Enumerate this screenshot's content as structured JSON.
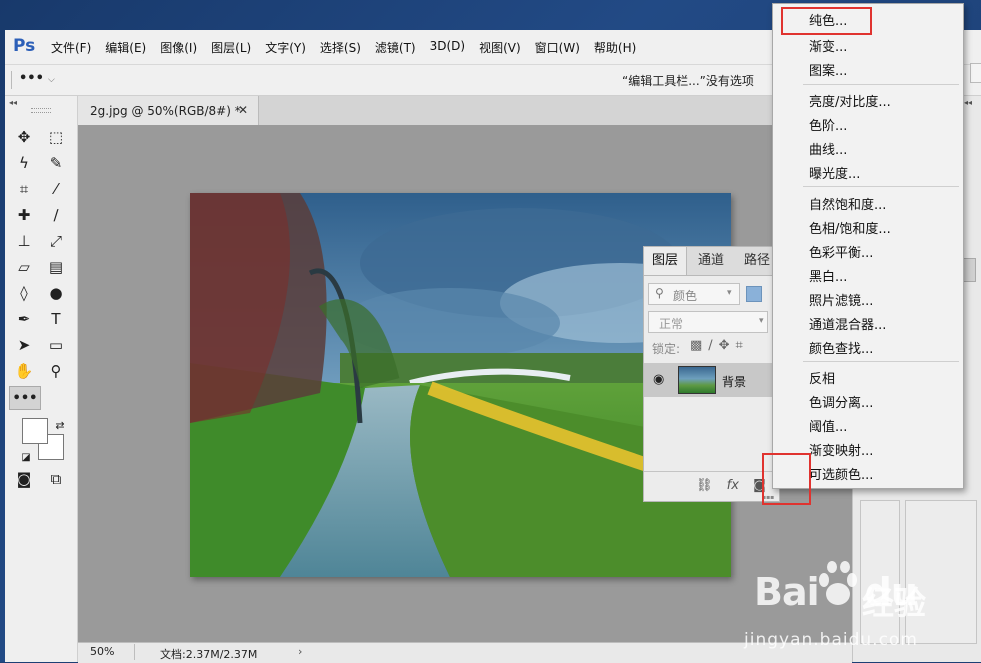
{
  "app": {
    "logo": "Ps"
  },
  "menubar": {
    "items": [
      "文件(F)",
      "编辑(E)",
      "图像(I)",
      "图层(L)",
      "文字(Y)",
      "选择(S)",
      "滤镜(T)",
      "3D(D)",
      "视图(V)",
      "窗口(W)",
      "帮助(H)"
    ]
  },
  "options_bar": {
    "tool_glyph": "•••",
    "message": "“编辑工具栏...”没有选项"
  },
  "document": {
    "tab_title": "2g.jpg @ 50%(RGB/8#) *",
    "close": "✕",
    "zoom": "50%",
    "doc_size": "文档:2.37M/2.37M",
    "status_arrow": "›"
  },
  "layers_panel": {
    "tabs": [
      "图层",
      "通道",
      "路径"
    ],
    "filter_placeholder": "颜色",
    "blend_mode": "正常",
    "lock_label": "锁定:",
    "layer_name": "背景",
    "footer_icons": [
      "link-icon",
      "fx-icon",
      "mask-icon",
      "adjustment-icon"
    ]
  },
  "adjustment_menu": {
    "groups": [
      [
        "纯色...",
        "渐变...",
        "图案..."
      ],
      [
        "亮度/对比度...",
        "色阶...",
        "曲线...",
        "曝光度..."
      ],
      [
        "自然饱和度...",
        "色相/饱和度...",
        "色彩平衡...",
        "黑白...",
        "照片滤镜...",
        "通道混合器...",
        "颜色查找..."
      ],
      [
        "反相",
        "色调分离...",
        "阈值...",
        "渐变映射...",
        "可选颜色..."
      ]
    ]
  },
  "watermark": {
    "logo": "Bai",
    "logo_tail": "du",
    "jingyan": "经验",
    "url": "jingyan.baidu.com"
  },
  "colors": {
    "highlight": "#e0332f",
    "ps_blue": "#2c5fb8",
    "panel_bg": "#ececec"
  }
}
